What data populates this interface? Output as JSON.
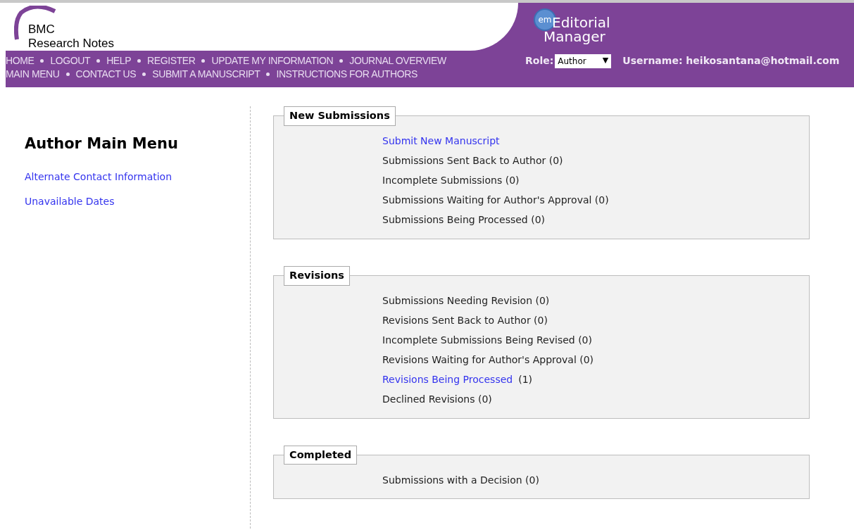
{
  "header": {
    "journal_logo": {
      "line1": "BMC",
      "line2": "Research Notes"
    },
    "nav_rows": [
      [
        "HOME",
        "LOGOUT",
        "HELP",
        "REGISTER",
        "UPDATE MY INFORMATION",
        "JOURNAL OVERVIEW"
      ],
      [
        "MAIN MENU",
        "CONTACT US",
        "SUBMIT A MANUSCRIPT",
        "INSTRUCTIONS FOR AUTHORS"
      ]
    ],
    "em_logo": {
      "badge": "em",
      "line1": "Editorial",
      "line2": "Manager"
    },
    "role_label": "Role:",
    "role_value": "Author",
    "role_caret": "▼",
    "username": "Username: heikosantana@hotmail.com"
  },
  "sidebar": {
    "title": "Author Main Menu",
    "links": [
      "Alternate Contact Information",
      "Unavailable Dates"
    ]
  },
  "sections": [
    {
      "title": "New Submissions",
      "items": [
        {
          "text": "Submit New Manuscript",
          "link": true
        },
        {
          "text": "Submissions Sent Back to Author (0)",
          "link": false
        },
        {
          "text": "Incomplete Submissions (0)",
          "link": false
        },
        {
          "text": "Submissions Waiting for Author's Approval (0)",
          "link": false
        },
        {
          "text": "Submissions Being Processed (0)",
          "link": false
        }
      ]
    },
    {
      "title": "Revisions",
      "items": [
        {
          "text": "Submissions Needing Revision (0)",
          "link": false
        },
        {
          "text": "Revisions Sent Back to Author (0)",
          "link": false
        },
        {
          "text": "Incomplete Submissions Being Revised (0)",
          "link": false
        },
        {
          "text": "Revisions Waiting for Author's Approval (0)",
          "link": false
        },
        {
          "text": "Revisions Being Processed",
          "link": true,
          "count": "(1)"
        },
        {
          "text": "Declined Revisions (0)",
          "link": false
        }
      ]
    },
    {
      "title": "Completed",
      "items": [
        {
          "text": "Submissions with a Decision (0)",
          "link": false
        }
      ]
    }
  ]
}
